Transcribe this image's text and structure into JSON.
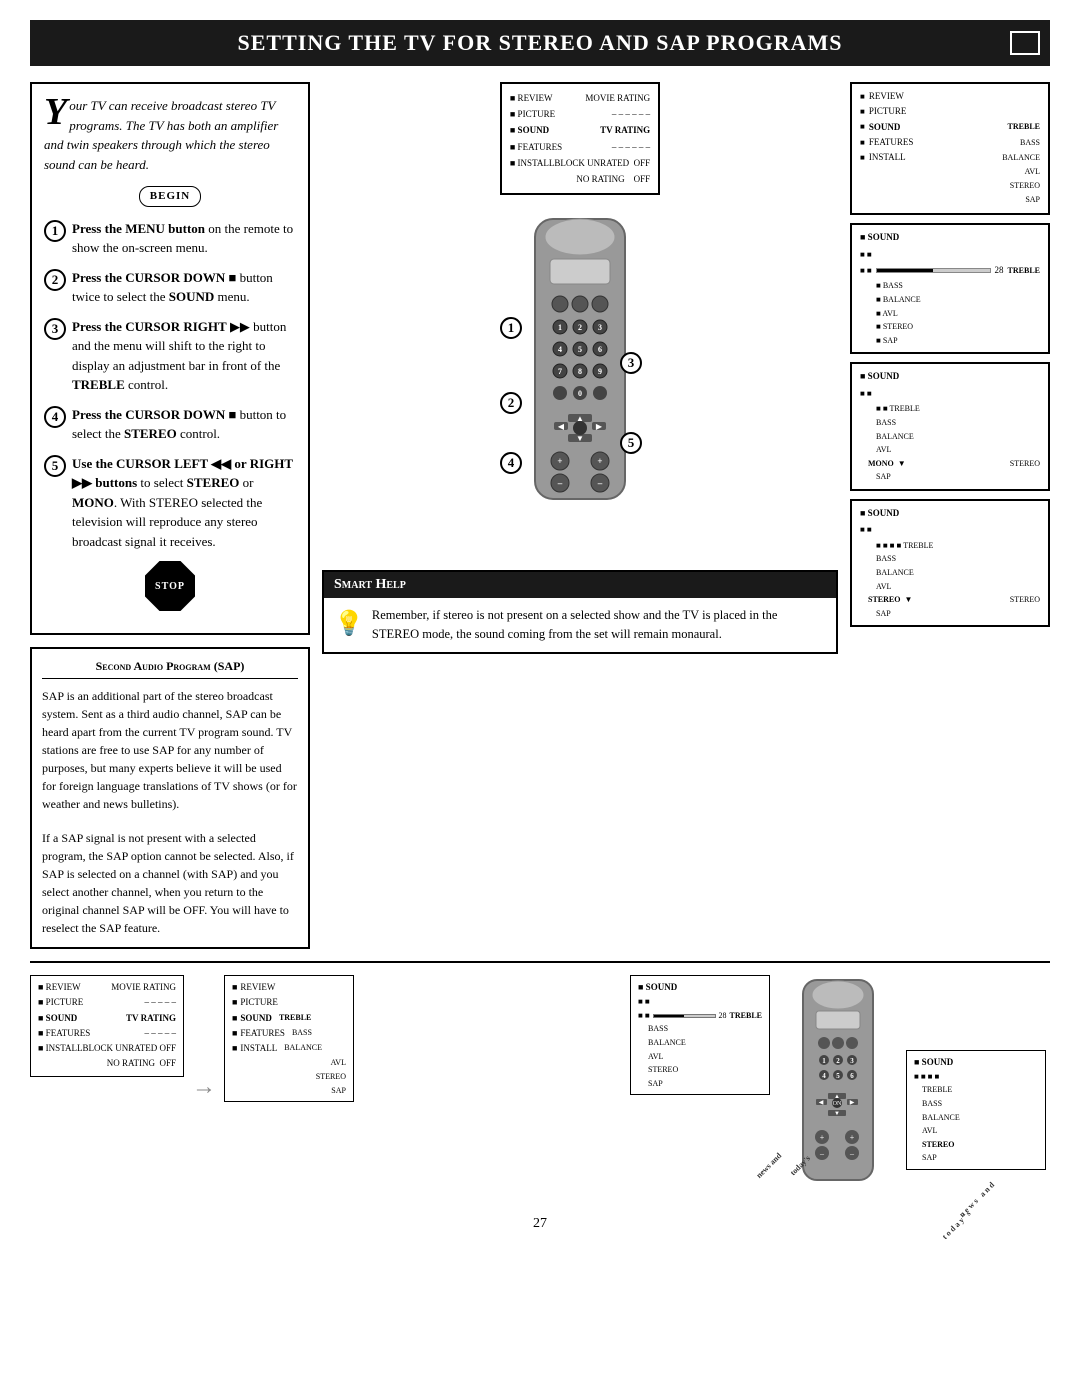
{
  "header": {
    "title": "Setting the TV for Stereo and SAP Programs",
    "title_display": "Sᴇᴛᴛɪᴋɢ ᴛʜᴇ TV ᶠᴏʀ Sᴛᴇʀᴇᴏ ᴀᴋᴅ SAP Pʀᴏɢʀᴀᴍᴄᴛʟᴄᴄ"
  },
  "intro": {
    "drop_cap": "Y",
    "text": "our TV can receive broadcast stereo TV programs. The TV has both an amplifier and twin speakers through which the stereo sound can be heard.",
    "begin_label": "BEGIN"
  },
  "steps": [
    {
      "num": "1",
      "text_bold": "Press the MENU button",
      "text_rest": " on the remote to show the on-screen menu."
    },
    {
      "num": "2",
      "text_bold": "Press the CURSOR DOWN",
      "text_rest": " button twice to select the ",
      "text_bold2": "SOUND",
      "text_rest2": " menu."
    },
    {
      "num": "3",
      "text_bold": "Press the CURSOR RIGHT",
      "text_rest": " button and the menu will shift to the right to display an adjustment bar in front of the ",
      "text_bold2": "TREBLE",
      "text_rest2": " control."
    },
    {
      "num": "4",
      "text_bold": "Press the CURSOR DOWN",
      "text_rest": " button to select the ",
      "text_bold2": "STEREO",
      "text_rest2": " control."
    },
    {
      "num": "5",
      "text_bold": "Use the CURSOR LEFT",
      "text_rest": " or ",
      "text_bold2": "RIGHT",
      "text_rest2": " buttons to select ",
      "text_bold3": "STEREO",
      "text_rest3": " or ",
      "text_bold4": "MONO",
      "text_rest4": ". With STEREO selected the television will reproduce any stereo broadcast signal it receives."
    }
  ],
  "stop_label": "STOP",
  "sap": {
    "title": "Second Audio Program (SAP)",
    "text1": "SAP is an additional part of the stereo broadcast system. Sent as a third audio channel, SAP can be heard apart from the current TV program sound. TV stations are free to use SAP for any number of purposes, but many experts believe it will be used for foreign language translations of TV shows (or for weather and news bulletins).",
    "text2": "If a SAP signal is not present with a selected program, the SAP option cannot be selected. Also, if SAP is selected on a channel (with SAP) and you select another channel, when you return to the original channel SAP will be OFF. You will have to reselect the SAP feature."
  },
  "smart_help": {
    "header": "Smart Help",
    "text": "Remember, if stereo is not present on a selected show and the TV is placed in the STEREO mode, the sound coming from the set will remain monaural."
  },
  "menu_screen_1": {
    "items": [
      {
        "label": "REVIEW",
        "value": "MOVIE RATING",
        "selected": false
      },
      {
        "label": "PICTURE",
        "value": "------",
        "selected": false
      },
      {
        "label": "SOUND",
        "value": "TV RATING",
        "selected": true
      },
      {
        "label": "FEATURES",
        "value": "------",
        "selected": false
      },
      {
        "label": "INSTALL",
        "value": "BLOCK UNRATED  OFF",
        "selected": false
      },
      {
        "label": "",
        "value": "NO RATING      OFF",
        "selected": false
      }
    ]
  },
  "menu_screen_2": {
    "header": "SOUND",
    "items": [
      {
        "label": "REVIEW",
        "selected": false
      },
      {
        "label": "PICTURE",
        "selected": false
      },
      {
        "label": "SOUND",
        "selected": true
      },
      {
        "label": "FEATURES",
        "selected": false
      },
      {
        "label": "INSTALL",
        "selected": false
      },
      {
        "label": "TREBLE",
        "right": true
      },
      {
        "label": "BASS",
        "right": true
      },
      {
        "label": "BALANCE",
        "right": true
      },
      {
        "label": "AVL",
        "right": true
      },
      {
        "label": "STEREO",
        "right": true
      },
      {
        "label": "SAP",
        "right": true
      }
    ]
  },
  "screen_treble": {
    "header": "SOUND",
    "treble_value": "28",
    "items": [
      "TREBLE",
      "BASS",
      "BALANCE",
      "AVL",
      "STEREO",
      "SAP"
    ]
  },
  "screen_stereo": {
    "header": "SOUND",
    "mono_label": "MONO",
    "items": [
      "TREBLE",
      "BASS",
      "BALANCE",
      "AVL",
      "STEREO",
      "SAP"
    ]
  },
  "screen_final": {
    "header": "SOUND",
    "stereo_label": "STEREO",
    "items": [
      "TREBLE",
      "BASS",
      "BALANCE",
      "AVL",
      "STEREO",
      "SAP"
    ]
  },
  "page_number": "27",
  "bottom": {
    "menu1_items": [
      {
        "label": "REVIEW",
        "value": "MOVIE RATING"
      },
      {
        "label": "PICTURE",
        "value": "------"
      },
      {
        "label": "SOUND",
        "value": "TV RATING",
        "selected": true
      },
      {
        "label": "FEATURES",
        "value": "------"
      },
      {
        "label": "INSTALL",
        "value": "BLOCK UNRATED  OFF"
      },
      {
        "label": "",
        "value": "NO RATING      OFF"
      }
    ],
    "menu2_items": [
      {
        "label": "REVIEW"
      },
      {
        "label": "PICTURE"
      },
      {
        "label": "SOUND",
        "selected": true
      },
      {
        "label": "FEATURES"
      },
      {
        "label": "INSTALL"
      },
      {
        "label": "TREBLE",
        "value": ""
      },
      {
        "label": "BASS"
      },
      {
        "label": "BALANCE"
      },
      {
        "label": "AVL"
      },
      {
        "label": "STEREO"
      },
      {
        "label": "SAP"
      }
    ],
    "screen_right_items": [
      "TREBLE",
      "BASS",
      "BALANCE",
      "AVL",
      "STEREO",
      "SAP"
    ],
    "news_text": "news and",
    "todays_text": "today's"
  }
}
